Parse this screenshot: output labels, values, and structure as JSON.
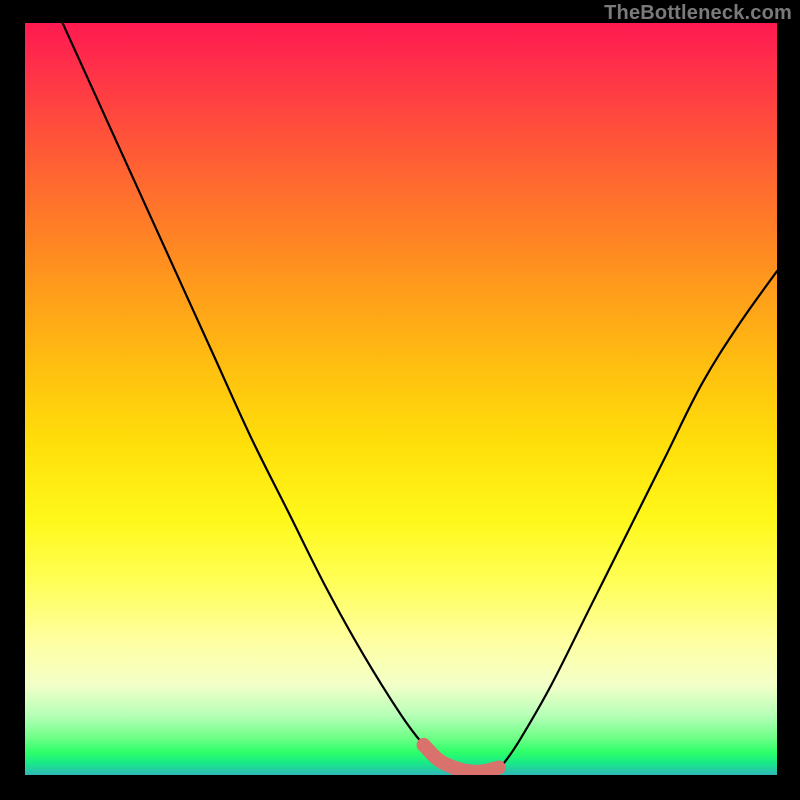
{
  "attribution": "TheBottleneck.com",
  "chart_data": {
    "type": "line",
    "title": "",
    "xlabel": "",
    "ylabel": "",
    "ylim": [
      0,
      100
    ],
    "xlim": [
      0,
      100
    ],
    "series": [
      {
        "name": "main-curve",
        "x": [
          5,
          10,
          15,
          20,
          25,
          30,
          35,
          40,
          45,
          50,
          53,
          55,
          57,
          59,
          61,
          63,
          64,
          66,
          70,
          75,
          80,
          85,
          90,
          95,
          100
        ],
        "y": [
          100,
          89,
          78,
          67,
          56,
          45,
          35,
          25,
          16,
          8,
          4,
          2,
          1,
          0.5,
          0.5,
          1,
          2,
          5,
          12,
          22,
          32,
          42,
          52,
          60,
          67
        ]
      },
      {
        "name": "highlight-band",
        "x": [
          53,
          55,
          57,
          59,
          61,
          63
        ],
        "y": [
          4,
          2,
          1,
          0.5,
          0.5,
          1
        ]
      }
    ],
    "colors": {
      "main_curve": "#000000",
      "highlight": "#d9716c",
      "gradient_top": "#ff1a51",
      "gradient_bottom": "#2fb6b8"
    }
  }
}
